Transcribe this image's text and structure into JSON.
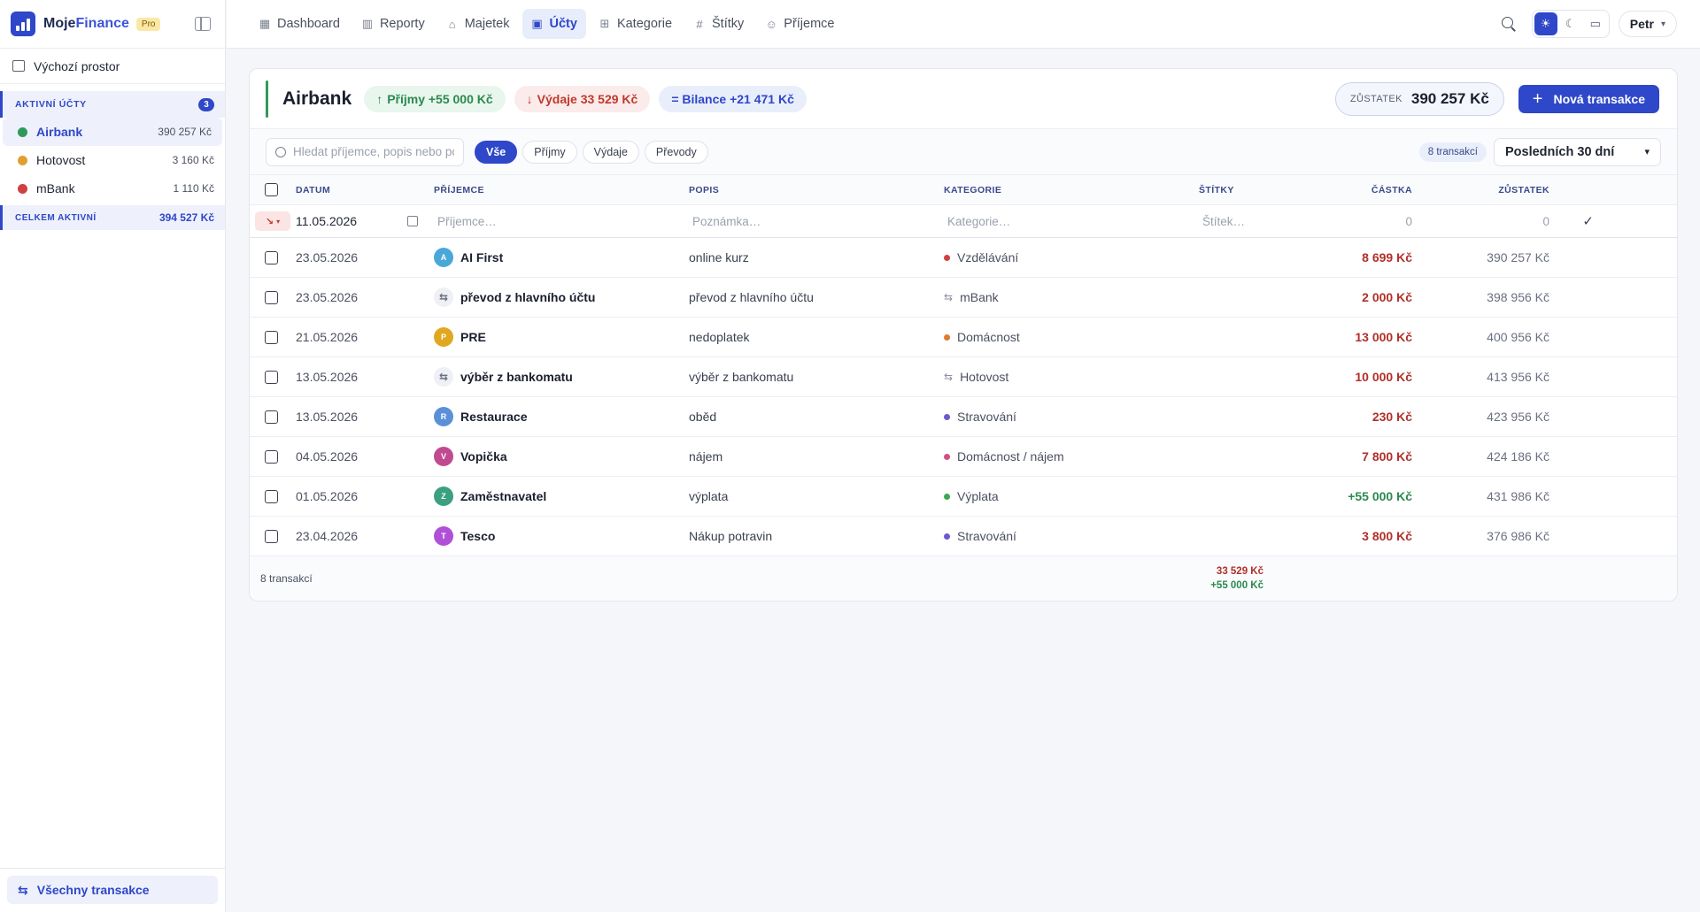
{
  "brand": {
    "name_a": "Moje",
    "name_b": "Finance",
    "plan": "Pro"
  },
  "sidebar": {
    "workspace": "Výchozí prostor",
    "section_label": "AKTIVNÍ ÚČTY",
    "section_count": "3",
    "accounts": [
      {
        "name": "Airbank",
        "amount": "390 257 Kč",
        "color": "#2e9a5a"
      },
      {
        "name": "Hotovost",
        "amount": "3 160 Kč",
        "color": "#e0a030"
      },
      {
        "name": "mBank",
        "amount": "1 110 Kč",
        "color": "#d04040"
      }
    ],
    "total_label": "CELKEM AKTIVNÍ",
    "total_value": "394 527 Kč",
    "all_transactions": "Všechny transakce"
  },
  "nav": [
    {
      "label": "Dashboard",
      "icon": "grid-icon",
      "glyph": "▦"
    },
    {
      "label": "Reporty",
      "icon": "bar-chart-icon",
      "glyph": "▥"
    },
    {
      "label": "Majetek",
      "icon": "bank-icon",
      "glyph": "⌂"
    },
    {
      "label": "Účty",
      "icon": "wallet-icon",
      "glyph": "▣"
    },
    {
      "label": "Kategorie",
      "icon": "categories-icon",
      "glyph": "⊞"
    },
    {
      "label": "Štítky",
      "icon": "hash-icon",
      "glyph": "#"
    },
    {
      "label": "Příjemce",
      "icon": "users-icon",
      "glyph": "☺"
    }
  ],
  "user": "Petr",
  "account": {
    "name": "Airbank",
    "income": "Příjmy +55 000 Kč",
    "expenses": "Výdaje 33 529 Kč",
    "balance_diff": "= Bilance +21 471 Kč",
    "balance_label": "ZŮSTATEK",
    "balance_value": "390 257 Kč",
    "new_tx": "Nová transakce"
  },
  "filters": {
    "search_placeholder": "Hledat příjemce, popis nebo poznámku",
    "segments": [
      "Vše",
      "Příjmy",
      "Výdaje",
      "Převody"
    ],
    "count": "8 transakcí",
    "period": "Posledních 30 dní"
  },
  "table": {
    "headers": [
      "DATUM",
      "PŘÍJEMCE",
      "POPIS",
      "KATEGORIE",
      "ŠTÍTKY",
      "ČÁSTKA",
      "ZŮSTATEK"
    ],
    "new_row": {
      "date": "11.05.2026",
      "payee_ph": "Příjemce…",
      "note_ph": "Poznámka…",
      "category_ph": "Kategorie…",
      "tag_ph": "Štítek…",
      "amount": "0",
      "balance": "0"
    },
    "rows": [
      {
        "date": "23.05.2026",
        "payee": "AI First",
        "initial": "A",
        "avatar": "#4aa8d8",
        "transfer": false,
        "desc": "online kurz",
        "category": "Vzdělávání",
        "cat_color": "#d04040",
        "amount": "8 699 Kč",
        "type": "exp",
        "balance": "390 257 Kč"
      },
      {
        "date": "23.05.2026",
        "payee": "převod z hlavního účtu",
        "initial": "⇆",
        "avatar": "#eef0f5",
        "transfer": true,
        "desc": "převod z hlavního účtu",
        "category": "mBank",
        "cat_color": "",
        "amount": "2 000 Kč",
        "type": "exp",
        "balance": "398 956 Kč"
      },
      {
        "date": "21.05.2026",
        "payee": "PRE",
        "initial": "P",
        "avatar": "#e0a820",
        "transfer": false,
        "desc": "nedoplatek",
        "category": "Domácnost",
        "cat_color": "#e07a30",
        "amount": "13 000 Kč",
        "type": "exp",
        "balance": "400 956 Kč"
      },
      {
        "date": "13.05.2026",
        "payee": "výběr z bankomatu",
        "initial": "⇆",
        "avatar": "#eef0f5",
        "transfer": true,
        "desc": "výběr z bankomatu",
        "category": "Hotovost",
        "cat_color": "",
        "amount": "10 000 Kč",
        "type": "exp",
        "balance": "413 956 Kč"
      },
      {
        "date": "13.05.2026",
        "payee": "Restaurace",
        "initial": "R",
        "avatar": "#5a90d8",
        "transfer": false,
        "desc": "oběd",
        "category": "Stravování",
        "cat_color": "#6a5ad0",
        "amount": "230 Kč",
        "type": "exp",
        "balance": "423 956 Kč"
      },
      {
        "date": "04.05.2026",
        "payee": "Vopička",
        "initial": "V",
        "avatar": "#c04a90",
        "transfer": false,
        "desc": "nájem",
        "category": "Domácnost / nájem",
        "cat_color": "#d05080",
        "amount": "7 800 Kč",
        "type": "exp",
        "balance": "424 186 Kč"
      },
      {
        "date": "01.05.2026",
        "payee": "Zaměstnavatel",
        "initial": "Z",
        "avatar": "#3aa080",
        "transfer": false,
        "desc": "výplata",
        "category": "Výplata",
        "cat_color": "#3aa850",
        "amount": "+55 000 Kč",
        "type": "inc",
        "balance": "431 986 Kč"
      },
      {
        "date": "23.04.2026",
        "payee": "Tesco",
        "initial": "T",
        "avatar": "#b050d8",
        "transfer": false,
        "desc": "Nákup potravin",
        "category": "Stravování",
        "cat_color": "#6a5ad0",
        "amount": "3 800 Kč",
        "type": "exp",
        "balance": "376 986 Kč"
      }
    ],
    "footer_count": "8 transakcí",
    "footer_expense": "33 529 Kč",
    "footer_income": "+55 000 Kč"
  }
}
